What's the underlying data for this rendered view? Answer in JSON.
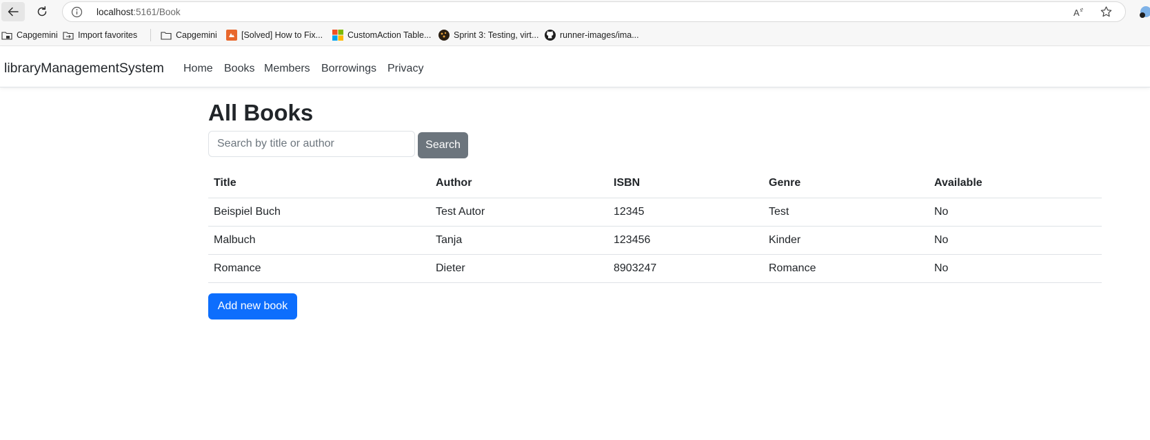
{
  "browser": {
    "url_host": "localhost",
    "url_path": ":5161/Book"
  },
  "bookmarks": [
    {
      "label": "Capgemini",
      "icon": "folder-lock-icon"
    },
    {
      "label": "Import favorites",
      "icon": "import-icon"
    },
    {
      "label": "Capgemini",
      "icon": "folder-icon"
    },
    {
      "label": "[Solved] How to Fix...",
      "icon": "site-icon"
    },
    {
      "label": "CustomAction Table...",
      "icon": "microsoft-icon"
    },
    {
      "label": "Sprint 3: Testing, virt...",
      "icon": "sprint-icon"
    },
    {
      "label": "runner-images/ima...",
      "icon": "github-icon"
    }
  ],
  "navbar": {
    "brand": "libraryManagementSystem",
    "links": [
      "Home",
      "Books",
      "Members",
      "Borrowings",
      "Privacy"
    ]
  },
  "main": {
    "title": "All Books",
    "search_placeholder": "Search by title or author",
    "search_label": "Search",
    "add_label": "Add new book"
  },
  "table": {
    "headers": [
      "Title",
      "Author",
      "ISBN",
      "Genre",
      "Available"
    ],
    "rows": [
      [
        "Beispiel Buch",
        "Test Autor",
        "12345",
        "Test",
        "No"
      ],
      [
        "Malbuch",
        "Tanja",
        "123456",
        "Kinder",
        "No"
      ],
      [
        "Romance",
        "Dieter",
        "8903247",
        "Romance",
        "No"
      ]
    ]
  },
  "colors": {
    "primary": "#0d6efd",
    "secondary": "#6c757d"
  }
}
